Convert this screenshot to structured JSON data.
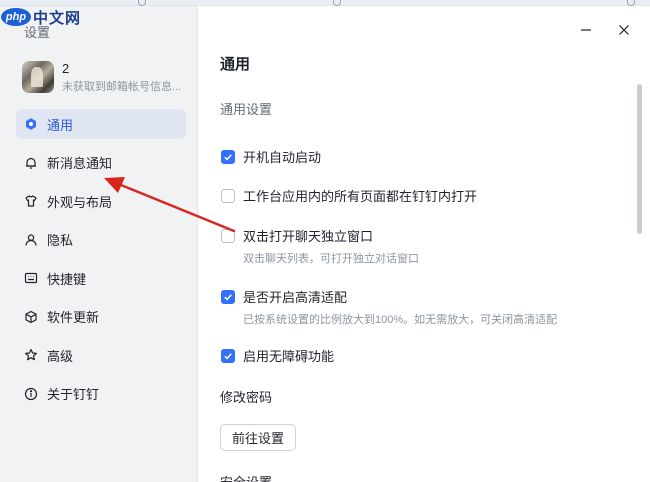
{
  "watermark": {
    "logo": "php",
    "text": "中文网"
  },
  "sidebar": {
    "title": "设置",
    "profile": {
      "name": "2",
      "subtitle": "未获取到邮箱帐号信息..."
    },
    "items": [
      {
        "label": "通用",
        "icon": "settings-dot-icon",
        "active": true
      },
      {
        "label": "新消息通知",
        "icon": "bell-icon"
      },
      {
        "label": "外观与布局",
        "icon": "shirt-icon"
      },
      {
        "label": "隐私",
        "icon": "person-icon"
      },
      {
        "label": "快捷键",
        "icon": "keyboard-icon"
      },
      {
        "label": "软件更新",
        "icon": "cube-icon"
      },
      {
        "label": "高级",
        "icon": "star-icon"
      },
      {
        "label": "关于钉钉",
        "icon": "info-icon"
      }
    ]
  },
  "main": {
    "title": "通用",
    "section": "通用设置",
    "options": [
      {
        "label": "开机自动启动",
        "checked": true
      },
      {
        "label": "工作台应用内的所有页面都在钉钉内打开",
        "checked": false
      },
      {
        "label": "双击打开聊天独立窗口",
        "checked": false,
        "desc": "双击聊天列表，可打开独立对话窗口"
      },
      {
        "label": "是否开启高清适配",
        "checked": true,
        "desc": "已按系统设置的比例放大到100%。如无需放大，可关闭高清适配"
      },
      {
        "label": "启用无障碍功能",
        "checked": true
      }
    ],
    "password": {
      "heading": "修改密码",
      "button": "前往设置"
    },
    "cut_heading": "安全设置"
  },
  "colors": {
    "accent": "#3370ff",
    "active_bg": "#dfe6f2",
    "arrow": "#d9251d"
  }
}
